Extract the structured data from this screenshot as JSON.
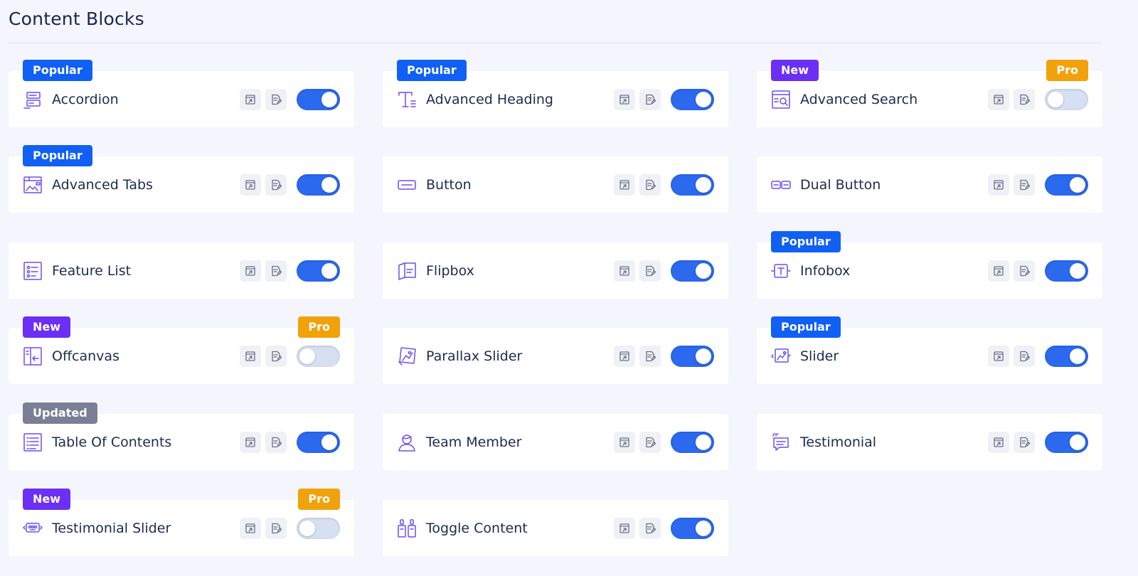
{
  "page": {
    "title": "Content Blocks"
  },
  "colors": {
    "accent": "#2b69ef",
    "popular": "#1060f5",
    "new": "#6b2ff5",
    "pro": "#f1a20b",
    "updated": "#7b7f95",
    "icon": "#6c4ff0"
  },
  "actions": {
    "demo_icon": "external-link-icon",
    "doc_icon": "document-icon"
  },
  "blocks": [
    {
      "label": "Accordion",
      "icon": "accordion-icon",
      "badge": "Popular",
      "pro": "",
      "enabled": true
    },
    {
      "label": "Advanced Heading",
      "icon": "heading-icon",
      "badge": "Popular",
      "pro": "",
      "enabled": true
    },
    {
      "label": "Advanced Search",
      "icon": "search-icon",
      "badge": "New",
      "pro": "Pro",
      "enabled": false
    },
    {
      "label": "Advanced Tabs",
      "icon": "tabs-icon",
      "badge": "Popular",
      "pro": "",
      "enabled": true
    },
    {
      "label": "Button",
      "icon": "button-icon",
      "badge": "",
      "pro": "",
      "enabled": true
    },
    {
      "label": "Dual Button",
      "icon": "dual-button-icon",
      "badge": "",
      "pro": "",
      "enabled": true
    },
    {
      "label": "Feature List",
      "icon": "feature-list-icon",
      "badge": "",
      "pro": "",
      "enabled": true
    },
    {
      "label": "Flipbox",
      "icon": "flipbox-icon",
      "badge": "",
      "pro": "",
      "enabled": true
    },
    {
      "label": "Infobox",
      "icon": "infobox-icon",
      "badge": "Popular",
      "pro": "",
      "enabled": true
    },
    {
      "label": "Offcanvas",
      "icon": "offcanvas-icon",
      "badge": "New",
      "pro": "Pro",
      "enabled": false
    },
    {
      "label": "Parallax Slider",
      "icon": "parallax-slider-icon",
      "badge": "",
      "pro": "",
      "enabled": true
    },
    {
      "label": "Slider",
      "icon": "slider-icon",
      "badge": "Popular",
      "pro": "",
      "enabled": true
    },
    {
      "label": "Table Of Contents",
      "icon": "table-of-contents-icon",
      "badge": "Updated",
      "pro": "",
      "enabled": true
    },
    {
      "label": "Team Member",
      "icon": "team-member-icon",
      "badge": "",
      "pro": "",
      "enabled": true
    },
    {
      "label": "Testimonial",
      "icon": "testimonial-icon",
      "badge": "",
      "pro": "",
      "enabled": true
    },
    {
      "label": "Testimonial Slider",
      "icon": "testimonial-slider-icon",
      "badge": "New",
      "pro": "Pro",
      "enabled": false
    },
    {
      "label": "Toggle Content",
      "icon": "toggle-content-icon",
      "badge": "",
      "pro": "",
      "enabled": true
    }
  ]
}
